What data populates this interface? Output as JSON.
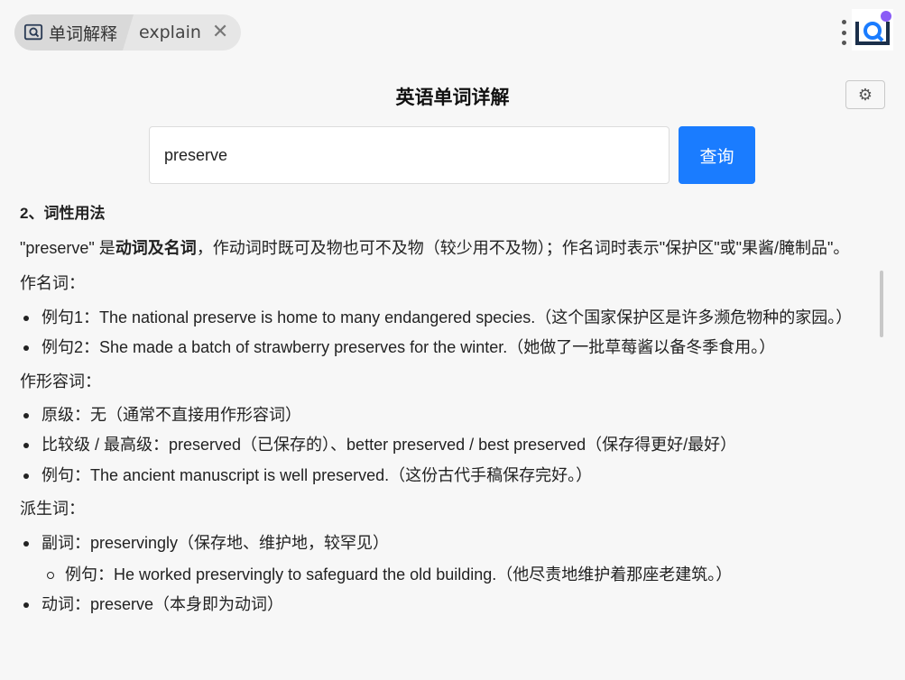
{
  "tabs": [
    {
      "label": "单词解释"
    },
    {
      "label": "explain"
    }
  ],
  "header": {
    "title": "英语单词详解",
    "settings_icon": "gear-icon"
  },
  "search": {
    "value": "preserve",
    "button_label": "查询"
  },
  "content": {
    "heading": "2、词性用法",
    "intro_pre": "\"preserve\" 是",
    "intro_bold": "动词及名词",
    "intro_post": "，作动词时既可及物也可不及物（较少用不及物）；作名词时表示\"保护区\"或\"果酱/腌制品\"。",
    "noun_label": "作名词：",
    "noun_items": [
      "例句1：The national preserve is home to many endangered species.（这个国家保护区是许多濒危物种的家园。）",
      "例句2：She made a batch of strawberry preserves for the winter.（她做了一批草莓酱以备冬季食用。）"
    ],
    "adj_label": "作形容词：",
    "adj_items": [
      "原级：无（通常不直接用作形容词）",
      "比较级 / 最高级：preserved（已保存的）、better preserved / best preserved（保存得更好/最好）",
      "例句：The ancient manuscript is well preserved.（这份古代手稿保存完好。）"
    ],
    "deriv_label": "派生词：",
    "deriv_items": [
      "副词：preservingly（保存地、维护地，较罕见）",
      "动词：preserve（本身即为动词）"
    ],
    "deriv_nested": [
      "例句：He worked preservingly to safeguard the old building.（他尽责地维护着那座老建筑。）"
    ]
  }
}
